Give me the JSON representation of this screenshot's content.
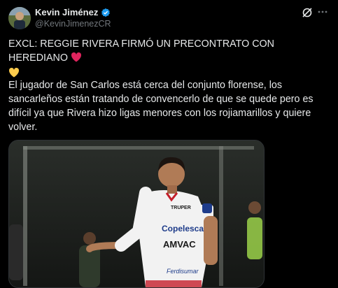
{
  "author": {
    "display_name": "Kevin Jiménez",
    "handle": "@KevinJimenezCR",
    "verified": true
  },
  "tweet": {
    "headline": "EXCL: REGGIE RIVERA FIRMÓ UN PRECONTRATO CON HEREDIANO",
    "body": "El jugador de San Carlos está cerca del conjunto florense, los sancarleños están tratando de convencerlo de que se quede pero es difícil ya que Rivera hizo ligas menores con los rojiamarillos y quiere volver.",
    "emojis": [
      "red-heart",
      "yellow-heart"
    ]
  },
  "media": {
    "jersey_sponsors": [
      "TRUPER",
      "Copelesca",
      "AMVAC",
      "Ferdisumar"
    ]
  },
  "colors": {
    "background": "#000000",
    "text": "#e7e9ea",
    "secondary_text": "#71767b",
    "verified": "#1d9bf0",
    "heart_red": "#e0245e",
    "heart_yellow": "#ffcc4d"
  }
}
